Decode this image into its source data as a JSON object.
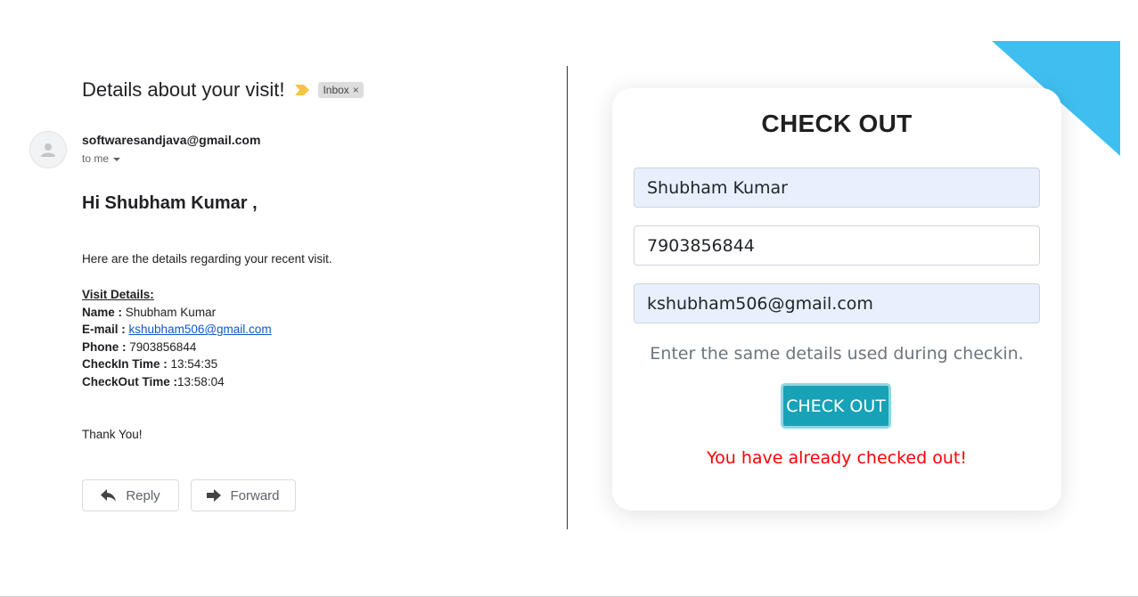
{
  "email": {
    "subject": "Details about your visit!",
    "label": "Inbox",
    "label_close": "×",
    "sender": "softwaresandjava@gmail.com",
    "recipient": "to me",
    "greeting": "Hi Shubham Kumar ,",
    "intro": "Here are the details regarding your recent visit.",
    "details_heading": "Visit Details:",
    "name_key": "Name :",
    "name_value": " Shubham Kumar",
    "email_key": "E-mail :",
    "email_value": "kshubham506@gmail.com",
    "phone_key": "Phone :",
    "phone_value": " 7903856844",
    "checkin_key": "CheckIn Time :",
    "checkin_value": " 13:54:35",
    "checkout_key": "CheckOut Time :",
    "checkout_value": "13:58:04",
    "thanks": "Thank You!",
    "reply_label": "Reply",
    "forward_label": "Forward",
    "icons": {
      "importance": "importance-marker-icon",
      "avatar": "person-icon",
      "reply": "reply-arrow-icon",
      "forward": "forward-arrow-icon"
    }
  },
  "checkout": {
    "title": "CHECK OUT",
    "name_value": "Shubham Kumar",
    "phone_value": "7903856844",
    "email_value": "kshubham506@gmail.com",
    "hint": "Enter the same details used during checkin.",
    "button_label": "CHECK OUT",
    "error": "You have already checked out!"
  },
  "colors": {
    "accent": "#17a2b8",
    "error": "#ff0000",
    "autofill": "#e8f0fe",
    "corner": "#3fbff0",
    "link": "#1155cc",
    "importance": "#f6c342"
  }
}
